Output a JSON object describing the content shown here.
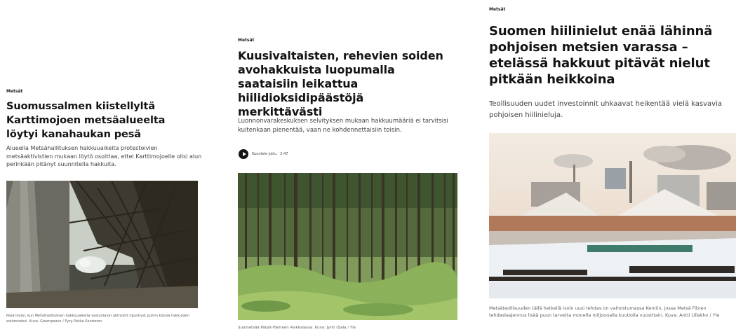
{
  "articles": [
    {
      "category": "Metsät",
      "title": "Suomussalmen kiistellyltä Karttimojoen metsäalueelta löytyi kanahaukan pesä",
      "lead": "Alueella Metsähallituksen hakkuuaikeita protestoivien metsäaktivistien mukaan löytö osoittaa, ettei Karttimojoelle olisi alun perinkään pitänyt suunnitella hakkuita.",
      "caption": "Pesä löytyi, kun Metsähallituksen hakkuuaikeita vastustavat aktivistit ripustivat puihin köysiä hakkuiden estämiseksi. Kuva: Greenpeace / Pyry-Pekka Kantonen"
    },
    {
      "category": "Metsät",
      "title": "Kuusivaltaisten, rehevien soiden avohakkuista luopumalla saataisiin leikattua hiilidioksidipäästöjä merkittävästi",
      "lead": "Luonnonvarakeskuksen selvityksen mukaan hakkuumääriä ei tarvitsisi kuitenkaan pienentää, vaan ne kohdennettaisiin toisin.",
      "listen_label": "Kuuntele juttu",
      "listen_duration": "2:47",
      "caption": "Suometsää Päijät-Hämeen Asikkalassa. Kuva: Jyrki Ojala / Yle"
    },
    {
      "category": "Metsät",
      "title": "Suomen hiilinielut enää lähinnä pohjoisen metsien varassa – etelässä hakkuut pitävät nielut pitkään heikkoina",
      "lead": "Teollisuuden uudet investoinnit uhkaavat heikentää vielä kasvavia pohjoisen hiilinieluja.",
      "caption": "Metsäteollisuuden tällä hetkellä isoin uusi tehdas on valmistumassa Kemiin, jossa Metsä Fibren tehdaslaajennus lisää puun tarvetta monella miljoonalla kuutiolla vuosittain. Kuva: Antti Ullakko / Yle"
    }
  ]
}
